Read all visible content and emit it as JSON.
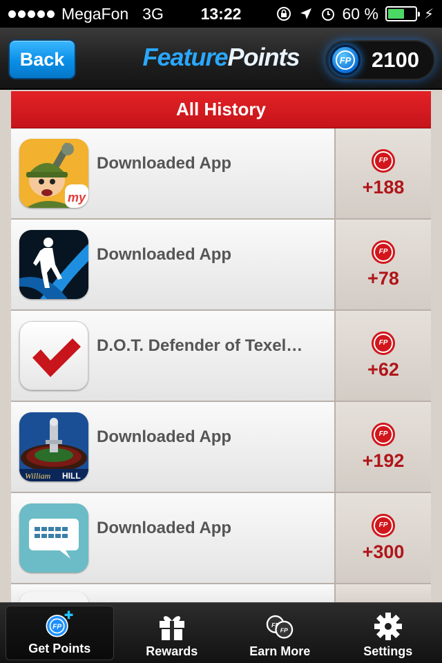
{
  "status_bar": {
    "carrier": "MegaFon",
    "network": "3G",
    "time": "13:22",
    "battery_percent": "60 %",
    "battery_level": 0.6
  },
  "header": {
    "back_label": "Back",
    "brand_part1": "Feature",
    "brand_part2": "Points",
    "coin_label": "FP",
    "points_total": "2100"
  },
  "section": {
    "title": "All History"
  },
  "history": [
    {
      "title": "Downloaded App",
      "points": "+188",
      "icon": "soldier-app-icon"
    },
    {
      "title": "Downloaded App",
      "points": "+78",
      "icon": "runner-app-icon"
    },
    {
      "title": "D.O.T. Defender of Texel ...",
      "points": "+62",
      "icon": "checkmark-app-icon"
    },
    {
      "title": "Downloaded App",
      "points": "+192",
      "icon": "roulette-app-icon"
    },
    {
      "title": "Downloaded App",
      "points": "+300",
      "icon": "keyboard-chat-app-icon"
    }
  ],
  "coin_small_label": "FP",
  "tabs": [
    {
      "label": "Get Points",
      "icon": "fp-plus-icon",
      "active": true
    },
    {
      "label": "Rewards",
      "icon": "gift-icon",
      "active": false
    },
    {
      "label": "Earn More",
      "icon": "coins-icon",
      "active": false
    },
    {
      "label": "Settings",
      "icon": "gear-icon",
      "active": false
    }
  ],
  "colors": {
    "accent_blue": "#0a8fe6",
    "section_red": "#d2161c",
    "points_red": "#b0151a"
  }
}
